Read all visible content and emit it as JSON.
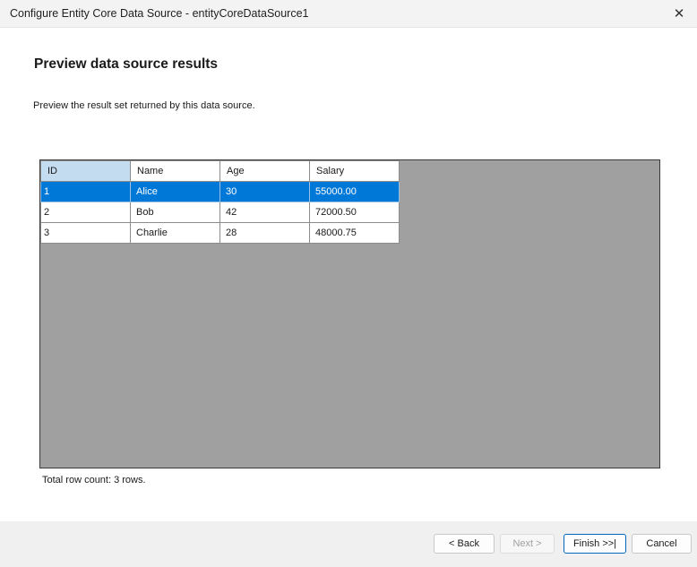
{
  "window": {
    "title": "Configure Entity Core Data Source - entityCoreDataSource1",
    "close_glyph": "✕"
  },
  "page": {
    "heading": "Preview data source results",
    "description": "Preview the result set returned by this data source."
  },
  "grid": {
    "columns": [
      "ID",
      "Name",
      "Age",
      "Salary"
    ],
    "selected_row": 0,
    "rows": [
      [
        "1",
        "Alice",
        "30",
        "55000.00"
      ],
      [
        "2",
        "Bob",
        "42",
        "72000.50"
      ],
      [
        "3",
        "Charlie",
        "28",
        "48000.75"
      ]
    ],
    "selection_color": "#0078d7",
    "empty_area_color": "#a0a0a0"
  },
  "status": {
    "row_count": "Total row count: 3 rows."
  },
  "buttons": {
    "back": "< Back",
    "next": "Next >",
    "finish": "Finish >>|",
    "cancel": "Cancel"
  }
}
